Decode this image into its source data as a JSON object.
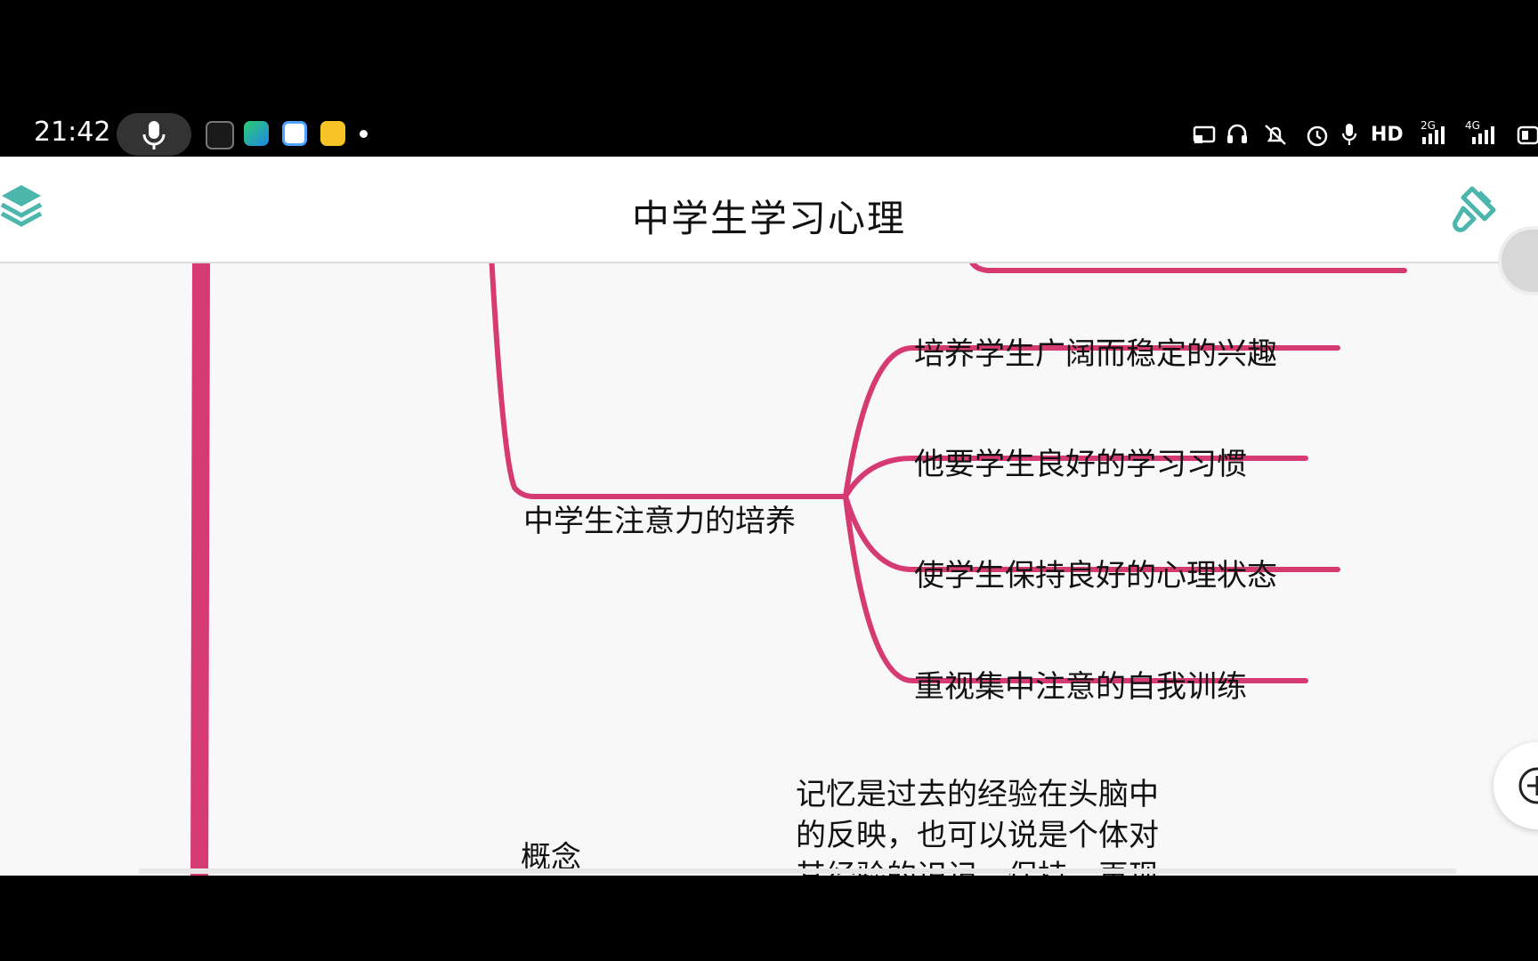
{
  "status_bar": {
    "time": "21:42",
    "network_label": "HD",
    "signal_2g": "2G",
    "signal_4g": "4G",
    "icons": [
      "microphone-icon",
      "cast-icon",
      "headset-icon",
      "mute-icon",
      "alarm-icon",
      "mic-small-icon",
      "battery-icon"
    ]
  },
  "app_bar": {
    "title": "中学生学习心理",
    "left_icon": "layers-icon",
    "right_icon": "brush-icon",
    "accent": "#4db6ac"
  },
  "mindmap": {
    "line_color": "#d63a72",
    "branch": {
      "label": "中学生注意力的培养",
      "children": [
        {
          "label": "培养学生广阔而稳定的兴趣"
        },
        {
          "label": "他要学生良好的学习习惯"
        },
        {
          "label": "使学生保持良好的心理状态"
        },
        {
          "label": "重视集中注意的自我训练"
        }
      ]
    },
    "next_branch": {
      "label": "概念",
      "description_lines": [
        "记忆是过去的经验在头脑中",
        "的反映，也可以说是个体对",
        "其经验的识记、保持、再现"
      ]
    }
  }
}
